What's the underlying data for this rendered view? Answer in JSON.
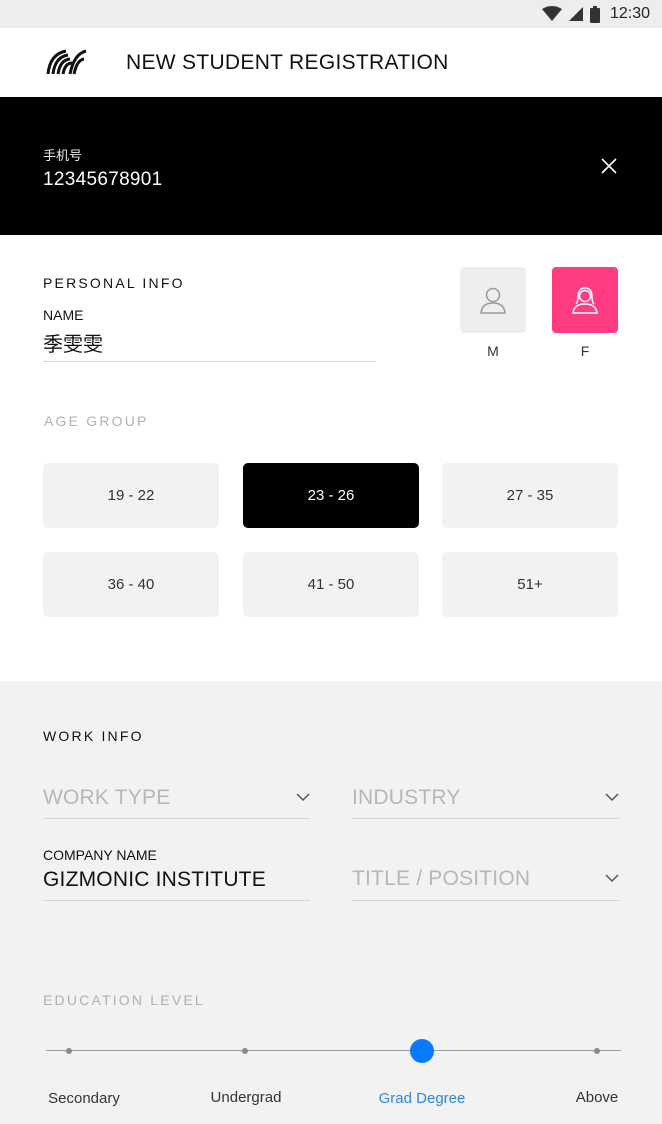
{
  "status_bar": {
    "time": "12:30",
    "icons": [
      "wifi-icon",
      "cell-signal-icon",
      "battery-icon"
    ]
  },
  "app_bar": {
    "title": "NEW STUDENT REGISTRATION",
    "logo_text": "EF"
  },
  "phone": {
    "label": "手机号",
    "value": "12345678901"
  },
  "personal": {
    "section_title": "PERSONAL INFO",
    "name_label": "NAME",
    "name_value": "季雯雯",
    "gender": {
      "male_label": "M",
      "female_label": "F",
      "selected": "F"
    }
  },
  "age": {
    "section_title": "AGE GROUP",
    "options": [
      "19 - 22",
      "23 - 26",
      "27 - 35",
      "36 - 40",
      "41 - 50",
      "51+"
    ],
    "selected": "23 - 26"
  },
  "work": {
    "section_title": "WORK INFO",
    "work_type_placeholder": "WORK TYPE",
    "industry_placeholder": "INDUSTRY",
    "company_label": "COMPANY NAME",
    "company_value": "GIZMONIC INSTITUTE",
    "title_placeholder": "TITLE / POSITION"
  },
  "education": {
    "section_title": "EDUCATION LEVEL",
    "levels": [
      "Secondary",
      "Undergrad",
      "Grad Degree",
      "Above"
    ],
    "selected": "Grad Degree"
  },
  "colors": {
    "accent_pink": "#ff3b82",
    "accent_blue": "#0a7bff",
    "selected_bg": "#000000",
    "button_bg": "#f2f2f2"
  }
}
